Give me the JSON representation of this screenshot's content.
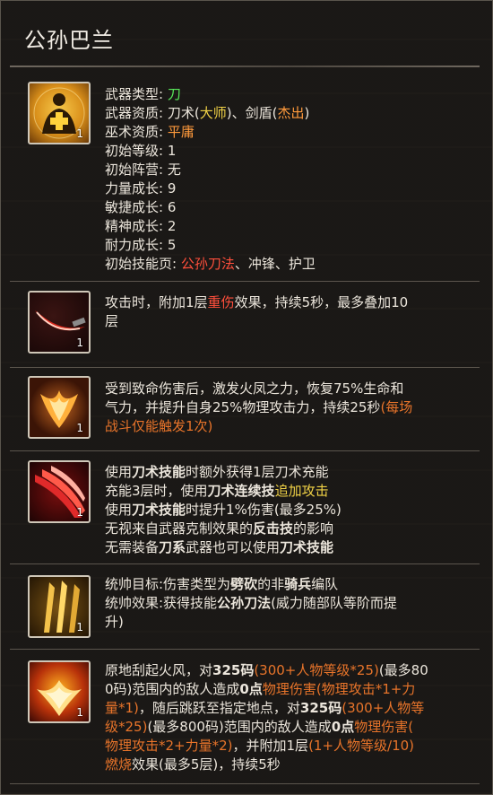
{
  "title": "公孙巴兰",
  "info": {
    "rows": [
      {
        "k": "武器类型:",
        "v": "刀"
      },
      {
        "k": "武器资质:",
        "v_a": "刀术(",
        "v_b": "大师",
        "v_c": ")、剑盾(",
        "v_d": "杰出",
        "v_e": ")"
      },
      {
        "k": "巫术资质:",
        "v": "平庸"
      },
      {
        "k": "初始等级:",
        "v": "1"
      },
      {
        "k": "初始阵营:",
        "v": "无"
      },
      {
        "k": "力量成长:",
        "v": "9"
      },
      {
        "k": "敏捷成长:",
        "v": "6"
      },
      {
        "k": "精神成长:",
        "v": "2"
      },
      {
        "k": "耐力成长:",
        "v": "5"
      },
      {
        "k": "初始技能页:",
        "v_a": "公孙刀法",
        "v_b": "、冲锋、护卫"
      }
    ],
    "icon": {
      "name": "buff-figure-icon",
      "level": "1"
    }
  },
  "skills": [
    {
      "icon": {
        "name": "curved-blade-icon",
        "level": "1"
      },
      "lines": [
        [
          "攻击时，附加1层",
          ""
        ],
        [
          "重伤",
          "red"
        ],
        [
          "效果，持续5秒，最多叠加10",
          ""
        ]
      ],
      "line2": "层"
    },
    {
      "icon": {
        "name": "phoenix-feather-icon",
        "level": "1"
      },
      "l1": "受到致命伤害后，激发火凤之力，恢复75%生命和",
      "l2a": "气力，并提升自身25%物理攻击力，持续25秒",
      "l2b": "(每场",
      "l3": "战斗仅能触发1次)"
    },
    {
      "icon": {
        "name": "red-slash-icon",
        "level": "1"
      },
      "l1a": "使用",
      "l1b": "刀术技能",
      "l1c": "时额外获得1层刀术充能",
      "l2a": "充能3层时，使用",
      "l2b": "刀术连续技",
      "l2c": "追加攻击",
      "l3a": "使用",
      "l3b": "刀术技能",
      "l3c": "时提升1%伤害(最多25%)",
      "l4a": "无视来自武器克制效果的",
      "l4b": "反击技",
      "l4c": "的影响",
      "l5a": "无需装备",
      "l5b": "刀系",
      "l5c": "武器也可以使用",
      "l5d": "刀术技能"
    },
    {
      "icon": {
        "name": "golden-blades-icon",
        "level": "1"
      },
      "l1a": "统帅目标:伤害类型为",
      "l1b": "劈砍",
      "l1c": "的非",
      "l1d": "骑兵",
      "l1e": "编队",
      "l2a": "统帅效果:获得技能",
      "l2b": "公孙刀法",
      "l2c": "(威力随部队等阶而提",
      "l3": "升)"
    },
    {
      "icon": {
        "name": "fire-phoenix-icon",
        "level": "1"
      },
      "l1a": "原地刮起火风，对",
      "l1b": "325码",
      "l1c": "(300+人物等级*25)",
      "l1d": "(最多80",
      "l2a": "0码)范围内的敌人造成",
      "l2b": "0点",
      "l2c": "物理伤害(物理攻击*1+力",
      "l3a": "量*1)",
      "l3b": "，随后跳跃至指定地点，对",
      "l3c": "325码",
      "l3d": "(300+人物等",
      "l4a": "级*25)",
      "l4b": "(最多800码)范围内的敌人造成",
      "l4c": "0点",
      "l4d": "物理伤害(",
      "l5a": "物理攻击*2+力量*2)",
      "l5b": "，并附加1层",
      "l5c": "(1+人物等级/10)",
      "l6a": "燃烧",
      "l6b": "效果(最多5层)，持续5秒"
    }
  ],
  "colors": {
    "green": "#58e85a",
    "yellow": "#f1d246",
    "orange": "#ff9a3c",
    "red": "#ff4f3c"
  }
}
